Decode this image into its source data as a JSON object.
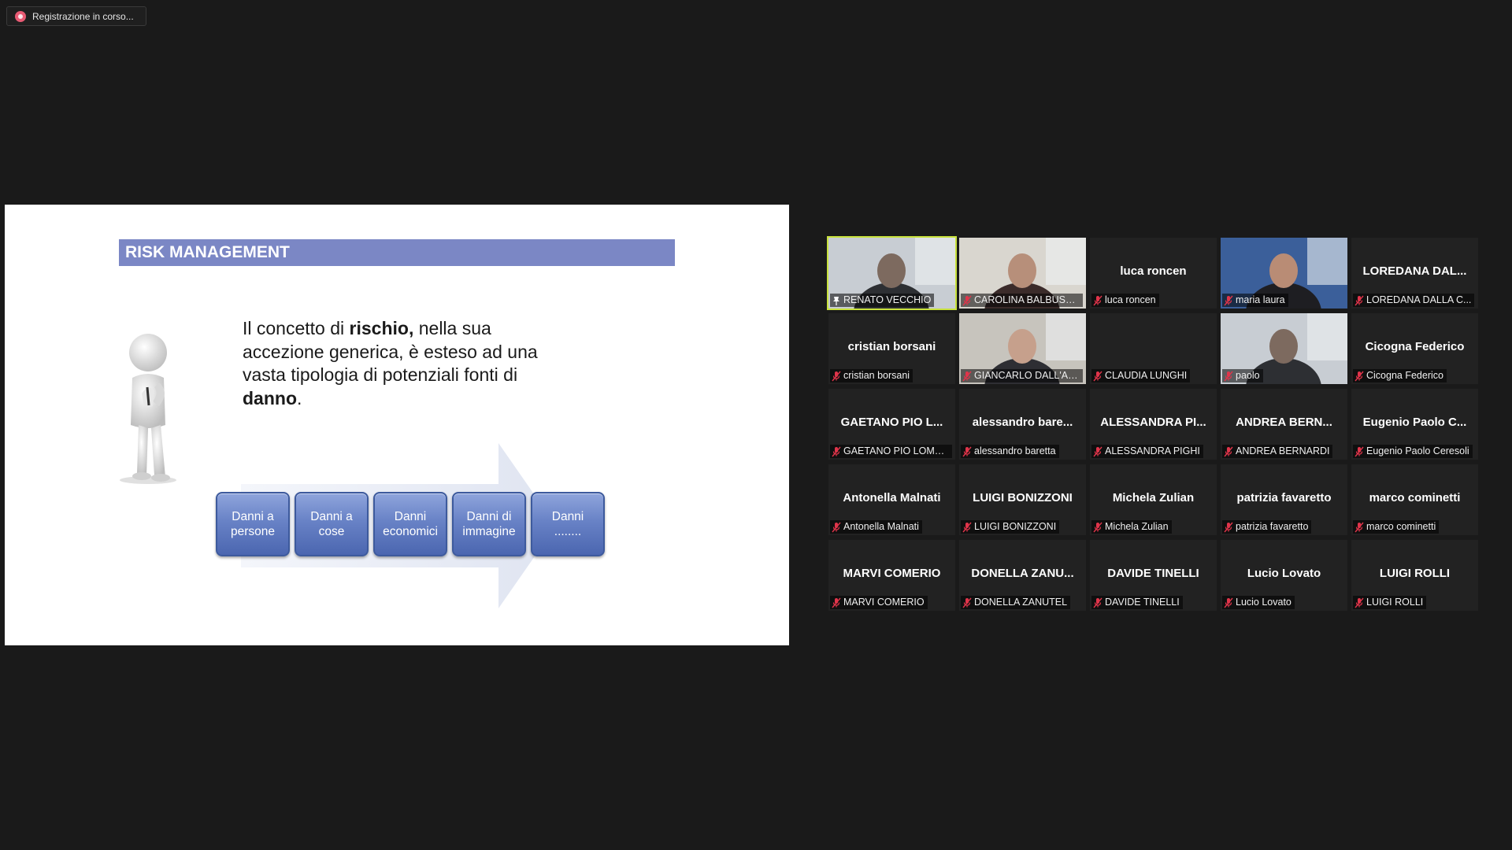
{
  "recording": {
    "label": "Registrazione in corso..."
  },
  "slide": {
    "title": "RISK MANAGEMENT",
    "text_parts": [
      "Il concetto di ",
      "rischio,",
      " nella sua accezione generica, è esteso ad una vasta tipologia di potenziali fonti di ",
      "danno",
      "."
    ],
    "boxes": [
      {
        "line1": "Danni a",
        "line2": "persone"
      },
      {
        "line1": "Danni a",
        "line2": "cose"
      },
      {
        "line1": "Danni",
        "line2": "economici"
      },
      {
        "line1": "Danni di",
        "line2": "immagine"
      },
      {
        "line1": "Danni",
        "line2": "........"
      }
    ]
  },
  "participants": [
    {
      "name": "",
      "label": "RENATO VECCHIO",
      "video": true,
      "active": true,
      "muted": false,
      "icon": "pin-icon"
    },
    {
      "name": "",
      "label": "CAROLINA BALBUSSO",
      "video": true,
      "muted": true
    },
    {
      "name": "luca roncen",
      "label": "luca roncen",
      "video": false,
      "muted": true
    },
    {
      "name": "",
      "label": "maria laura",
      "video": true,
      "muted": true
    },
    {
      "name": "LOREDANA DAL...",
      "label": "LOREDANA DALLA C...",
      "video": false,
      "muted": true
    },
    {
      "name": "cristian borsani",
      "label": "cristian borsani",
      "video": false,
      "muted": true
    },
    {
      "name": "",
      "label": "GIANCARLO DALL'ARA",
      "video": true,
      "muted": true
    },
    {
      "name": "",
      "label": "CLAUDIA LUNGHI",
      "video": false,
      "muted": true
    },
    {
      "name": "",
      "label": "paolo",
      "video": true,
      "muted": true
    },
    {
      "name": "Cicogna Federico",
      "label": "Cicogna Federico",
      "video": false,
      "muted": true
    },
    {
      "name": "GAETANO PIO L...",
      "label": "GAETANO PIO LOMB...",
      "video": false,
      "muted": true
    },
    {
      "name": "alessandro  bare...",
      "label": "alessandro baretta",
      "video": false,
      "muted": true
    },
    {
      "name": "ALESSANDRA PI...",
      "label": "ALESSANDRA PIGHI",
      "video": false,
      "muted": true
    },
    {
      "name": "ANDREA BERN...",
      "label": "ANDREA BERNARDI",
      "video": false,
      "muted": true
    },
    {
      "name": "Eugenio  Paolo  C...",
      "label": "Eugenio Paolo Ceresoli",
      "video": false,
      "muted": true
    },
    {
      "name": "Antonella Malnati",
      "label": "Antonella Malnati",
      "video": false,
      "muted": true
    },
    {
      "name": "LUIGI BONIZZONI",
      "label": "LUIGI BONIZZONI",
      "video": false,
      "muted": true
    },
    {
      "name": "Michela Zulian",
      "label": "Michela Zulian",
      "video": false,
      "muted": true
    },
    {
      "name": "patrizia favaretto",
      "label": "patrizia favaretto",
      "video": false,
      "muted": true
    },
    {
      "name": "marco cominetti",
      "label": "marco cominetti",
      "video": false,
      "muted": true
    },
    {
      "name": "MARVI COMERIO",
      "label": "MARVI COMERIO",
      "video": false,
      "muted": true
    },
    {
      "name": "DONELLA  ZANU...",
      "label": "DONELLA ZANUTEL",
      "video": false,
      "muted": true
    },
    {
      "name": "DAVIDE TINELLI",
      "label": "DAVIDE TINELLI",
      "video": false,
      "muted": true
    },
    {
      "name": "Lucio Lovato",
      "label": "Lucio Lovato",
      "video": false,
      "muted": true
    },
    {
      "name": "LUIGI ROLLI",
      "label": "LUIGI ROLLI",
      "video": false,
      "muted": true
    }
  ],
  "colors": {
    "background": "#1a1a1a",
    "tile": "#222222",
    "active_speaker": "#c9e23d",
    "muted_icon": "#e0344a",
    "slide_title_bar": "#7b87c5",
    "box_fill": "#5f79c0"
  }
}
